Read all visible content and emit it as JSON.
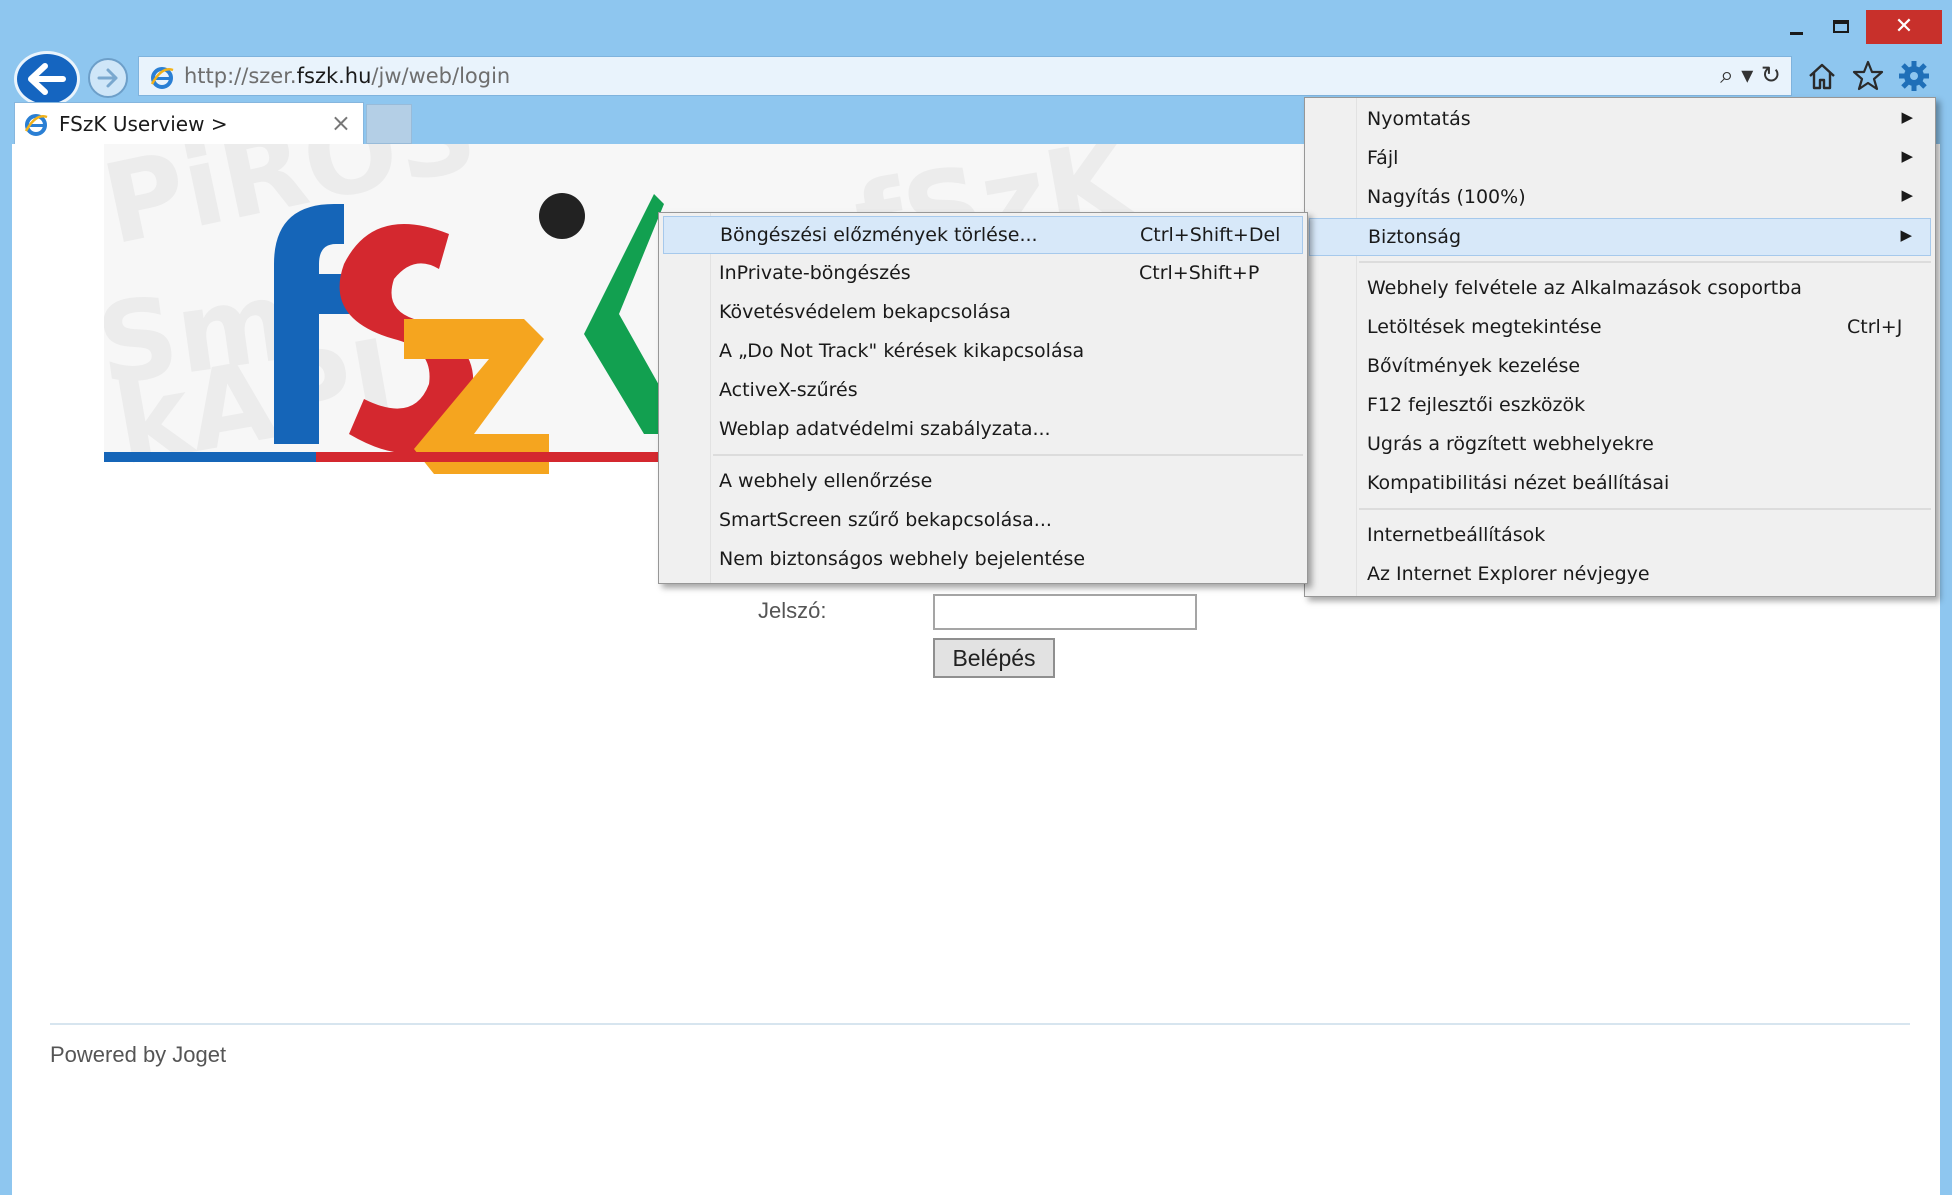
{
  "browser": {
    "url_prefix": "http://szer.",
    "url_domain": "fszk.hu",
    "url_path": "/jw/web/login",
    "address_tools": "⌕ ▾ ↻",
    "tab_title": "FSzK Userview  >",
    "tab_close": "×",
    "window_buttons": {
      "close": "✕"
    }
  },
  "page": {
    "password_label": "Jelszó:",
    "login_button": "Belépés",
    "footer": "Powered by Joget"
  },
  "main_menu": [
    {
      "label": "Nyomtatás",
      "arrow": "▶"
    },
    {
      "label": "Fájl",
      "arrow": "▶"
    },
    {
      "label": "Nagyítás (100%)",
      "arrow": "▶"
    },
    {
      "label": "Biztonság",
      "arrow": "▶"
    },
    {
      "label": "Webhely felvétele az Alkalmazások csoportba"
    },
    {
      "label": "Letöltések megtekintése",
      "shortcut": "Ctrl+J"
    },
    {
      "label": "Bővítmények kezelése"
    },
    {
      "label": "F12 fejlesztői eszközök"
    },
    {
      "label": "Ugrás a rögzített webhelyekre"
    },
    {
      "label": "Kompatibilitási nézet beállításai"
    },
    {
      "label": "Internetbeállítások"
    },
    {
      "label": "Az Internet Explorer névjegye"
    }
  ],
  "sub_menu": [
    {
      "label": "Böngészési előzmények törlése...",
      "shortcut": "Ctrl+Shift+Del"
    },
    {
      "label": "InPrivate-böngészés",
      "shortcut": "Ctrl+Shift+P"
    },
    {
      "label": "Követésvédelem bekapcsolása"
    },
    {
      "label": "A „Do Not Track\" kérések kikapcsolása"
    },
    {
      "label": "ActiveX-szűrés"
    },
    {
      "label": "Weblap adatvédelmi szabályzata..."
    },
    {
      "label": "A webhely ellenőrzése"
    },
    {
      "label": "SmartScreen szűrő bekapcsolása..."
    },
    {
      "label": "Nem biztonságos webhely bejelentése"
    }
  ],
  "colors": {
    "frame": "#8ec6ef",
    "close_button": "#c8302b",
    "menu_highlight": "#d7e8f9",
    "logo_blue": "#1565b8",
    "logo_red": "#d4282f",
    "logo_orange": "#f5a51f",
    "logo_green": "#12a050"
  }
}
